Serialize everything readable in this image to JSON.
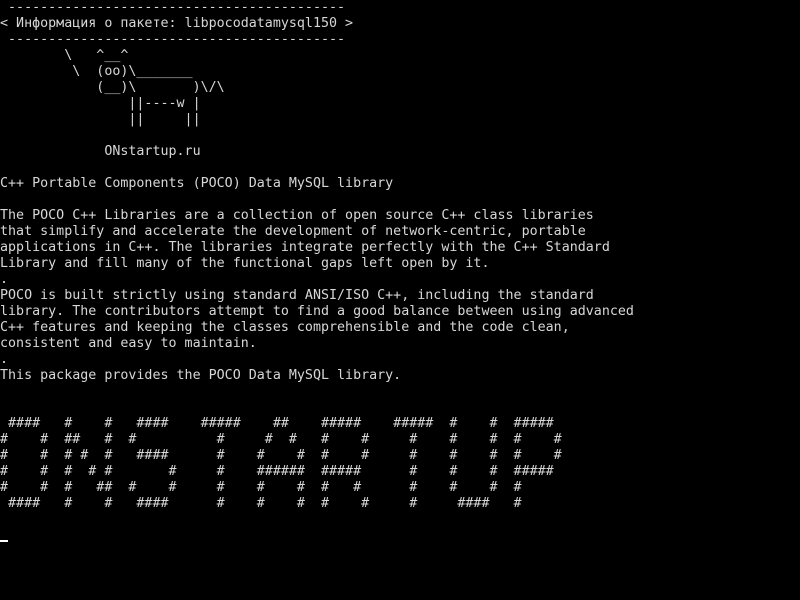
{
  "terminal": {
    "title_bar": {
      "rule_top": " ------------------------------------------",
      "title": "< Информация о пакете: libpocodatamysql150 >",
      "rule_bottom": " ------------------------------------------"
    },
    "art": [
      "        \\   ^__^",
      "         \\  (oo)\\_______",
      "            (__)\\       )\\/\\",
      "                ||----w |",
      "                ||     ||"
    ],
    "branding": "             ONstartup.ru",
    "summary": "C++ Portable Components (POCO) Data MySQL library",
    "description": [
      "The POCO C++ Libraries are a collection of open source C++ class libraries",
      "that simplify and accelerate the development of network-centric, portable",
      "applications in C++. The libraries integrate perfectly with the C++ Standard",
      "Library and fill many of the functional gaps left open by it.",
      ".",
      "POCO is built strictly using standard ANSI/ISO C++, including the standard",
      "library. The contributors attempt to find a good balance between using advanced",
      "C++ features and keeping the classes comprehensible and the code clean,",
      "consistent and easy to maintain.",
      ".",
      "This package provides the POCO Data MySQL library."
    ],
    "banner": [
      " ####   #    #   ####    #####    ##    #####    #####  #    #  #####",
      "#    #  ##   #  #          #     #  #   #    #     #    #    #  #    #",
      "#    #  # #  #   ####      #    #    #  #    #     #    #    #  #    #",
      "#    #  #  # #       #     #    ######  #####      #    #    #  #####",
      "#    #  #   ##  #    #     #    #    #  #   #      #    #    #  #",
      " ####   #    #   ####      #    #    #  #    #     #     ####   #"
    ]
  }
}
